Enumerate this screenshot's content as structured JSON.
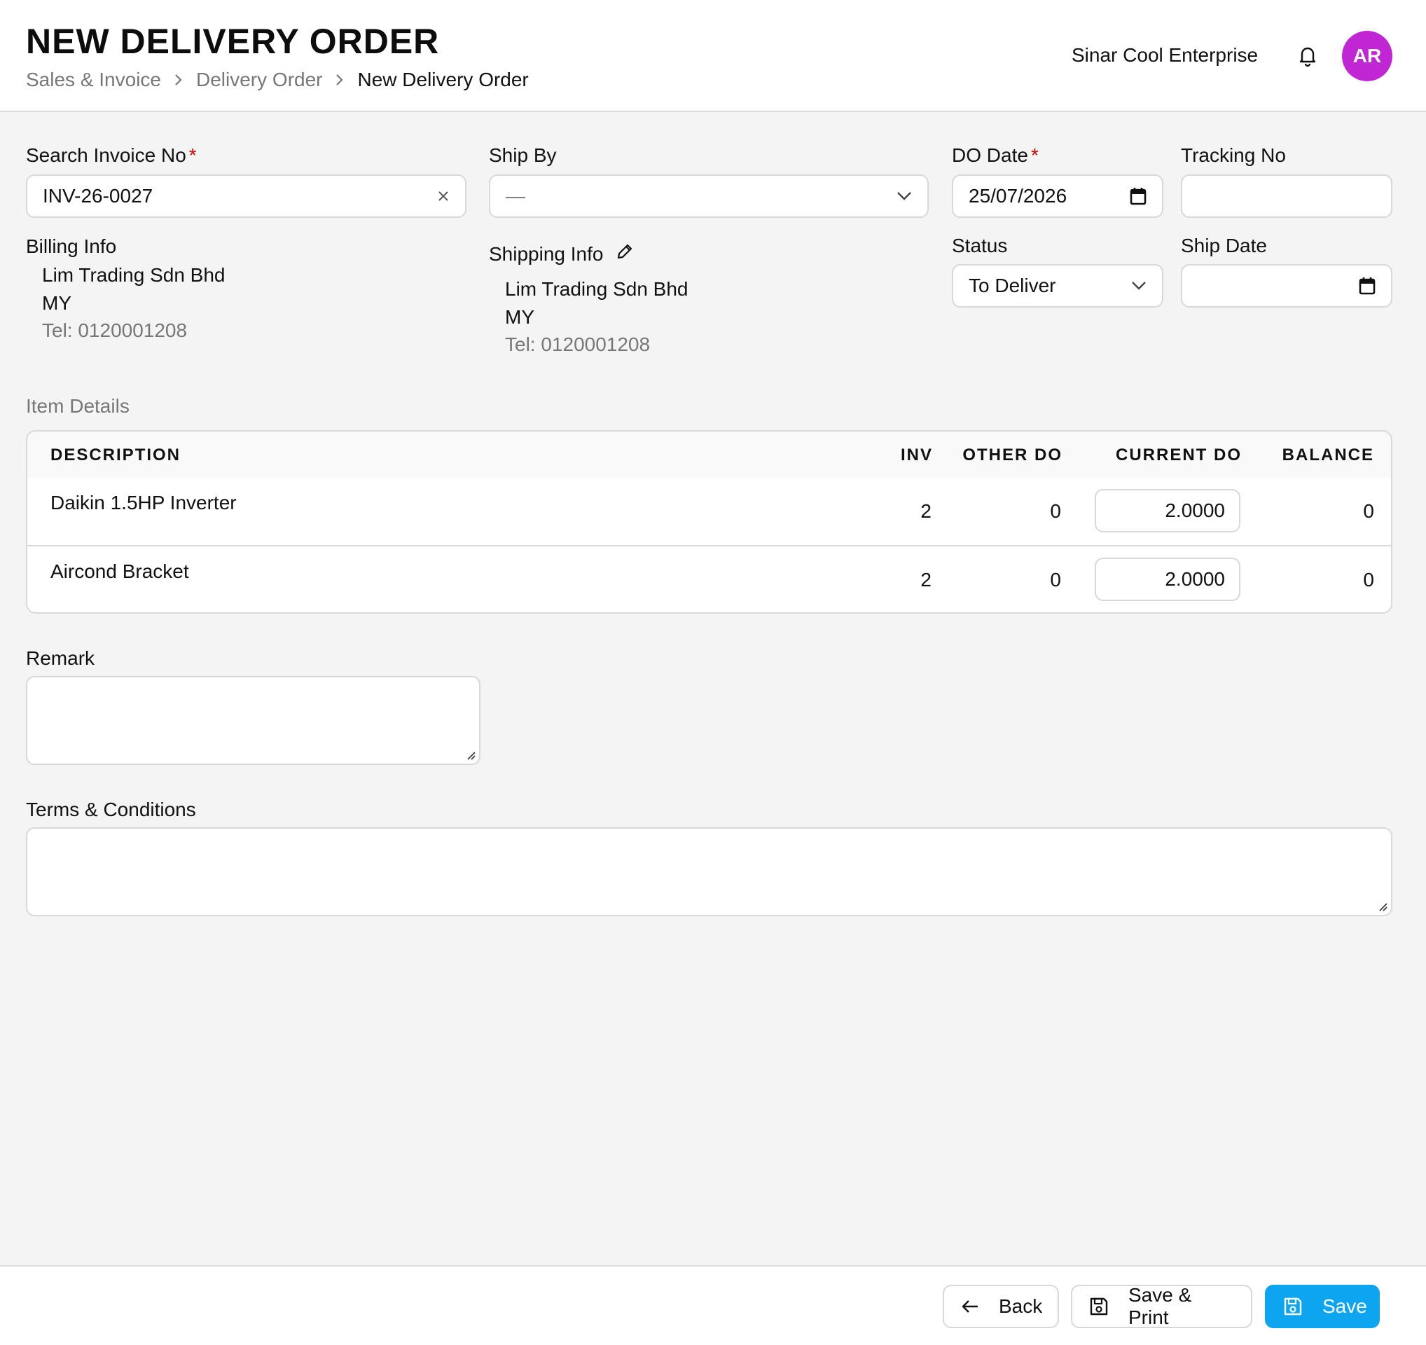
{
  "header": {
    "title": "NEW DELIVERY ORDER",
    "breadcrumb": [
      "Sales & Invoice",
      "Delivery Order",
      "New Delivery Order"
    ],
    "company": "Sinar Cool Enterprise",
    "avatar_initials": "AR",
    "avatar_color": "#c026d3"
  },
  "form": {
    "search_invoice": {
      "label": "Search Invoice No",
      "required_mark": "*",
      "value": "INV-26-0027"
    },
    "ship_by": {
      "label": "Ship By",
      "value": "—"
    },
    "do_date": {
      "label": "DO Date",
      "required_mark": "*",
      "value": "25/07/2026"
    },
    "tracking_no": {
      "label": "Tracking No",
      "value": ""
    },
    "status": {
      "label": "Status",
      "value": "To Deliver"
    },
    "ship_date": {
      "label": "Ship Date",
      "value": ""
    },
    "billing": {
      "label": "Billing Info",
      "name": "Lim Trading Sdn Bhd",
      "country": "MY",
      "tel": "Tel: 0120001208"
    },
    "shipping": {
      "label": "Shipping Info",
      "name": "Lim Trading Sdn Bhd",
      "country": "MY",
      "tel": "Tel: 0120001208"
    }
  },
  "items": {
    "section_label": "Item Details",
    "columns": [
      "DESCRIPTION",
      "INV",
      "OTHER DO",
      "CURRENT DO",
      "BALANCE"
    ],
    "rows": [
      {
        "description": "Daikin 1.5HP Inverter",
        "inv": "2",
        "other_do": "0",
        "current_do": "2.0000",
        "balance": "0"
      },
      {
        "description": "Aircond Bracket",
        "inv": "2",
        "other_do": "0",
        "current_do": "2.0000",
        "balance": "0"
      }
    ]
  },
  "remark": {
    "label": "Remark",
    "value": ""
  },
  "terms": {
    "label": "Terms & Conditions",
    "value": ""
  },
  "footer": {
    "back_label": "Back",
    "save_print_label": "Save & Print",
    "save_label": "Save",
    "primary_color": "#0ea5f0"
  },
  "icons": {
    "breadcrumb_separator": "chevron-right-icon",
    "notification": "bell-icon",
    "clear": "close-icon",
    "dropdown": "chevron-down-icon",
    "date": "calendar-icon",
    "edit": "pencil-icon",
    "back": "arrow-left-icon",
    "save": "floppy-disk-icon"
  }
}
